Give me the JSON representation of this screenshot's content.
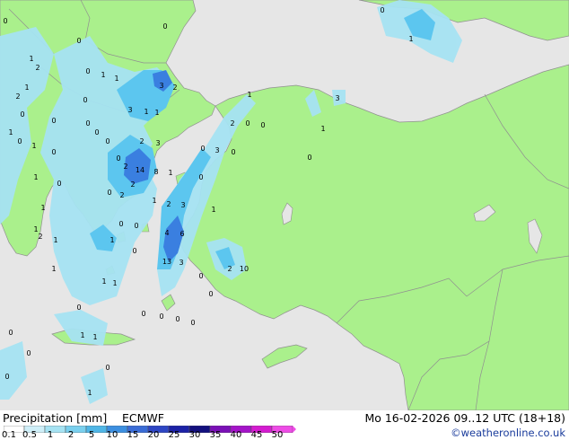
{
  "header": {
    "title": "Precipitation [mm]",
    "model": "ECMWF",
    "valid_time": "Mo 16-02-2026 09..12 UTC (18+18)",
    "credit": "©weatheronline.co.uk"
  },
  "legend": {
    "ticks": [
      "0.1",
      "0.5",
      "1",
      "2",
      "5",
      "10",
      "15",
      "20",
      "25",
      "30",
      "35",
      "40",
      "45",
      "50"
    ],
    "colors": [
      "#ffffff",
      "#cfeff8",
      "#a6e3f3",
      "#7ad0ee",
      "#4fb6e6",
      "#3c8fe0",
      "#3a6cd6",
      "#2e46c4",
      "#1c22a6",
      "#13107e",
      "#7a10b6",
      "#a414c8",
      "#d41cd0",
      "#ee4ce6"
    ]
  },
  "colors": {
    "land": "#aaf08c",
    "sea": "#e6e6e6",
    "border": "#909090",
    "precip_light": "#a6e3f3",
    "precip_mid": "#5cc6ef",
    "precip_heavy": "#3a7fe0"
  },
  "map": {
    "values": [
      "0",
      "1",
      "2",
      "1",
      "2",
      "0",
      "1",
      "0",
      "1",
      "1",
      "0",
      "0",
      "1",
      "1",
      "3",
      "2",
      "3",
      "1",
      "1",
      "0",
      "0",
      "0",
      "0",
      "2",
      "3",
      "0",
      "2",
      "14",
      "8",
      "1",
      "2",
      "2",
      "0",
      "1",
      "2",
      "0",
      "1",
      "3",
      "0",
      "1",
      "0",
      "1",
      "2",
      "1",
      "0",
      "0",
      "4",
      "6",
      "13",
      "3",
      "0",
      "2",
      "10",
      "1",
      "0",
      "1",
      "1",
      "1",
      "1",
      "1",
      "0",
      "0",
      "0",
      "0",
      "0",
      "0",
      "0",
      "0",
      "1",
      "0",
      "3",
      "0",
      "2",
      "1",
      "3",
      "0",
      "1",
      "1",
      "0",
      "0",
      "0",
      "0",
      "0",
      "0",
      "0"
    ]
  }
}
